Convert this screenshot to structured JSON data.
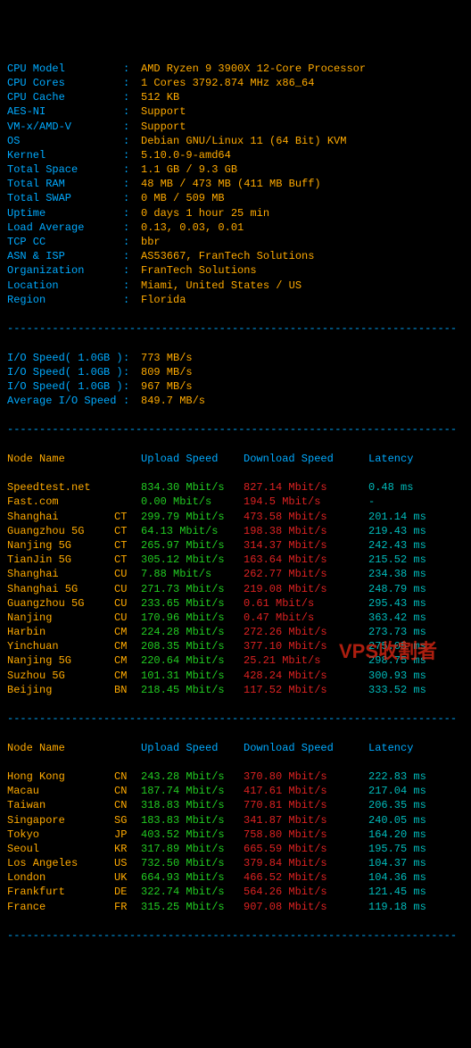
{
  "sysinfo": [
    {
      "label": "CPU Model",
      "value": "AMD Ryzen 9 3900X 12-Core Processor"
    },
    {
      "label": "CPU Cores",
      "value": "1 Cores 3792.874 MHz x86_64"
    },
    {
      "label": "CPU Cache",
      "value": "512 KB"
    },
    {
      "label": "AES-NI",
      "value": "Support"
    },
    {
      "label": "VM-x/AMD-V",
      "value": "Support"
    },
    {
      "label": "OS",
      "value": "Debian GNU/Linux 11 (64 Bit) KVM"
    },
    {
      "label": "Kernel",
      "value": "5.10.0-9-amd64"
    },
    {
      "label": "Total Space",
      "value": "1.1 GB / 9.3 GB"
    },
    {
      "label": "Total RAM",
      "value": "48 MB / 473 MB (411 MB Buff)"
    },
    {
      "label": "Total SWAP",
      "value": "0 MB / 509 MB"
    },
    {
      "label": "Uptime",
      "value": "0 days 1 hour 25 min"
    },
    {
      "label": "Load Average",
      "value": "0.13, 0.03, 0.01"
    },
    {
      "label": "TCP CC",
      "value": "bbr"
    },
    {
      "label": "ASN & ISP",
      "value": "AS53667, FranTech Solutions"
    },
    {
      "label": "Organization",
      "value": "FranTech Solutions"
    },
    {
      "label": "Location",
      "value": "Miami, United States / US"
    },
    {
      "label": "Region",
      "value": "Florida"
    }
  ],
  "iospeed": [
    {
      "label": "I/O Speed( 1.0GB )",
      "value": "773 MB/s"
    },
    {
      "label": "I/O Speed( 1.0GB )",
      "value": "809 MB/s"
    },
    {
      "label": "I/O Speed( 1.0GB )",
      "value": "967 MB/s"
    },
    {
      "label": "Average I/O Speed",
      "value": "849.7 MB/s"
    }
  ],
  "headers": {
    "node": "Node Name",
    "upload": "Upload Speed",
    "download": "Download Speed",
    "latency": "Latency"
  },
  "speedtest1": [
    {
      "name": "Speedtest.net",
      "loc": "",
      "up": "834.30 Mbit/s",
      "dl": "827.14 Mbit/s",
      "lat": "0.48 ms"
    },
    {
      "name": "Fast.com",
      "loc": "",
      "up": "0.00 Mbit/s",
      "dl": "194.5 Mbit/s",
      "lat": "-"
    },
    {
      "name": "Shanghai",
      "loc": "CT",
      "up": "299.79 Mbit/s",
      "dl": "473.58 Mbit/s",
      "lat": "201.14 ms"
    },
    {
      "name": "Guangzhou 5G",
      "loc": "CT",
      "up": "64.13 Mbit/s",
      "dl": "198.38 Mbit/s",
      "lat": "219.43 ms"
    },
    {
      "name": "Nanjing 5G",
      "loc": "CT",
      "up": "265.97 Mbit/s",
      "dl": "314.37 Mbit/s",
      "lat": "242.43 ms"
    },
    {
      "name": "TianJin 5G",
      "loc": "CT",
      "up": "305.12 Mbit/s",
      "dl": "163.64 Mbit/s",
      "lat": "215.52 ms"
    },
    {
      "name": "Shanghai",
      "loc": "CU",
      "up": "7.88 Mbit/s",
      "dl": "262.77 Mbit/s",
      "lat": "234.38 ms"
    },
    {
      "name": "Shanghai 5G",
      "loc": "CU",
      "up": "271.73 Mbit/s",
      "dl": "219.08 Mbit/s",
      "lat": "248.79 ms"
    },
    {
      "name": "Guangzhou 5G",
      "loc": "CU",
      "up": "233.65 Mbit/s",
      "dl": "0.61 Mbit/s",
      "lat": "295.43 ms"
    },
    {
      "name": "Nanjing",
      "loc": "CU",
      "up": "170.96 Mbit/s",
      "dl": "0.47 Mbit/s",
      "lat": "363.42 ms"
    },
    {
      "name": "Harbin",
      "loc": "CM",
      "up": "224.28 Mbit/s",
      "dl": "272.26 Mbit/s",
      "lat": "273.73 ms"
    },
    {
      "name": "Yinchuan",
      "loc": "CM",
      "up": "208.35 Mbit/s",
      "dl": "377.10 Mbit/s",
      "lat": "275.05 ms"
    },
    {
      "name": "Nanjing 5G",
      "loc": "CM",
      "up": "220.64 Mbit/s",
      "dl": "25.21 Mbit/s",
      "lat": "298.75 ms"
    },
    {
      "name": "Suzhou 5G",
      "loc": "CM",
      "up": "101.31 Mbit/s",
      "dl": "428.24 Mbit/s",
      "lat": "300.93 ms"
    },
    {
      "name": "Beijing",
      "loc": "BN",
      "up": "218.45 Mbit/s",
      "dl": "117.52 Mbit/s",
      "lat": "333.52 ms"
    }
  ],
  "speedtest2": [
    {
      "name": "Hong Kong",
      "loc": "CN",
      "up": "243.28 Mbit/s",
      "dl": "370.80 Mbit/s",
      "lat": "222.83 ms"
    },
    {
      "name": "Macau",
      "loc": "CN",
      "up": "187.74 Mbit/s",
      "dl": "417.61 Mbit/s",
      "lat": "217.04 ms"
    },
    {
      "name": "Taiwan",
      "loc": "CN",
      "up": "318.83 Mbit/s",
      "dl": "770.81 Mbit/s",
      "lat": "206.35 ms"
    },
    {
      "name": "Singapore",
      "loc": "SG",
      "up": "183.83 Mbit/s",
      "dl": "341.87 Mbit/s",
      "lat": "240.05 ms"
    },
    {
      "name": "Tokyo",
      "loc": "JP",
      "up": "403.52 Mbit/s",
      "dl": "758.80 Mbit/s",
      "lat": "164.20 ms"
    },
    {
      "name": "Seoul",
      "loc": "KR",
      "up": "317.89 Mbit/s",
      "dl": "665.59 Mbit/s",
      "lat": "195.75 ms"
    },
    {
      "name": "Los Angeles",
      "loc": "US",
      "up": "732.50 Mbit/s",
      "dl": "379.84 Mbit/s",
      "lat": "104.37 ms"
    },
    {
      "name": "London",
      "loc": "UK",
      "up": "664.93 Mbit/s",
      "dl": "466.52 Mbit/s",
      "lat": "104.36 ms"
    },
    {
      "name": "Frankfurt",
      "loc": "DE",
      "up": "322.74 Mbit/s",
      "dl": "564.26 Mbit/s",
      "lat": "121.45 ms"
    },
    {
      "name": "France",
      "loc": "FR",
      "up": "315.25 Mbit/s",
      "dl": "907.08 Mbit/s",
      "lat": "119.18 ms"
    }
  ],
  "watermark": "VPS收割者",
  "hr": "----------------------------------------------------------------------"
}
